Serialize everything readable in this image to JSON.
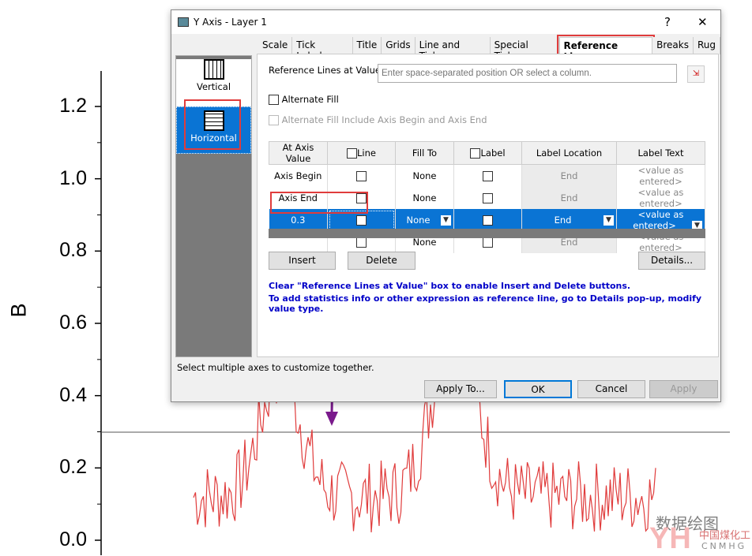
{
  "plot": {
    "y_axis_label": "B",
    "y_ticks": [
      "0.0",
      "0.2",
      "0.4",
      "0.6",
      "0.8",
      "1.0",
      "1.2"
    ],
    "y_range": [
      0,
      1.2
    ],
    "reference_line_value": 0.3,
    "line_color": "#e03c3c"
  },
  "dialog": {
    "title": "Y Axis - Layer 1",
    "help": "?",
    "close": "✕",
    "axes": [
      {
        "label": "Vertical"
      },
      {
        "label": "Horizontal",
        "selected": true
      }
    ],
    "tabs": [
      "Scale",
      "Tick Labels",
      "Title",
      "Grids",
      "Line and Ticks",
      "Special Ticks",
      "Reference Lines",
      "Breaks",
      "Rug"
    ],
    "active_tab": "Reference Lines",
    "ref_label": "Reference Lines at Value",
    "ref_placeholder": "Enter space-separated position OR select a column.",
    "alt_fill": "Alternate Fill",
    "alt_fill_include": "Alternate Fill Include Axis Begin and Axis End",
    "columns": [
      "At Axis Value",
      "Line",
      "Fill To",
      "Label",
      "Label Location",
      "Label Text"
    ],
    "rows": [
      {
        "value": "Axis Begin",
        "line": false,
        "fill": "None",
        "label": false,
        "loc": "End",
        "text": "<value as entered>"
      },
      {
        "value": "Axis End",
        "line": false,
        "fill": "None",
        "label": false,
        "loc": "End",
        "text": "<value as entered>"
      },
      {
        "value": "0.3",
        "line": true,
        "fill": "None",
        "label": false,
        "loc": "End",
        "text": "<value as entered>"
      },
      {
        "value": "",
        "line": false,
        "fill": "None",
        "label": false,
        "loc": "End",
        "text": "<value as entered>"
      }
    ],
    "insert": "Insert",
    "delete": "Delete",
    "details": "Details...",
    "info1": "Clear \"Reference Lines at Value\" box to enable Insert and Delete buttons.",
    "info2": "To add statistics info or other expression as reference line, go to Details pop-up, modify value type.",
    "status": "Select multiple axes to customize together.",
    "apply_to": "Apply To...",
    "ok": "OK",
    "cancel": "Cancel",
    "apply": "Apply"
  },
  "watermark": {
    "text1": "数据绘图",
    "text2": "中国煤化工",
    "text3": "CNMHG",
    "logo": "YH"
  }
}
